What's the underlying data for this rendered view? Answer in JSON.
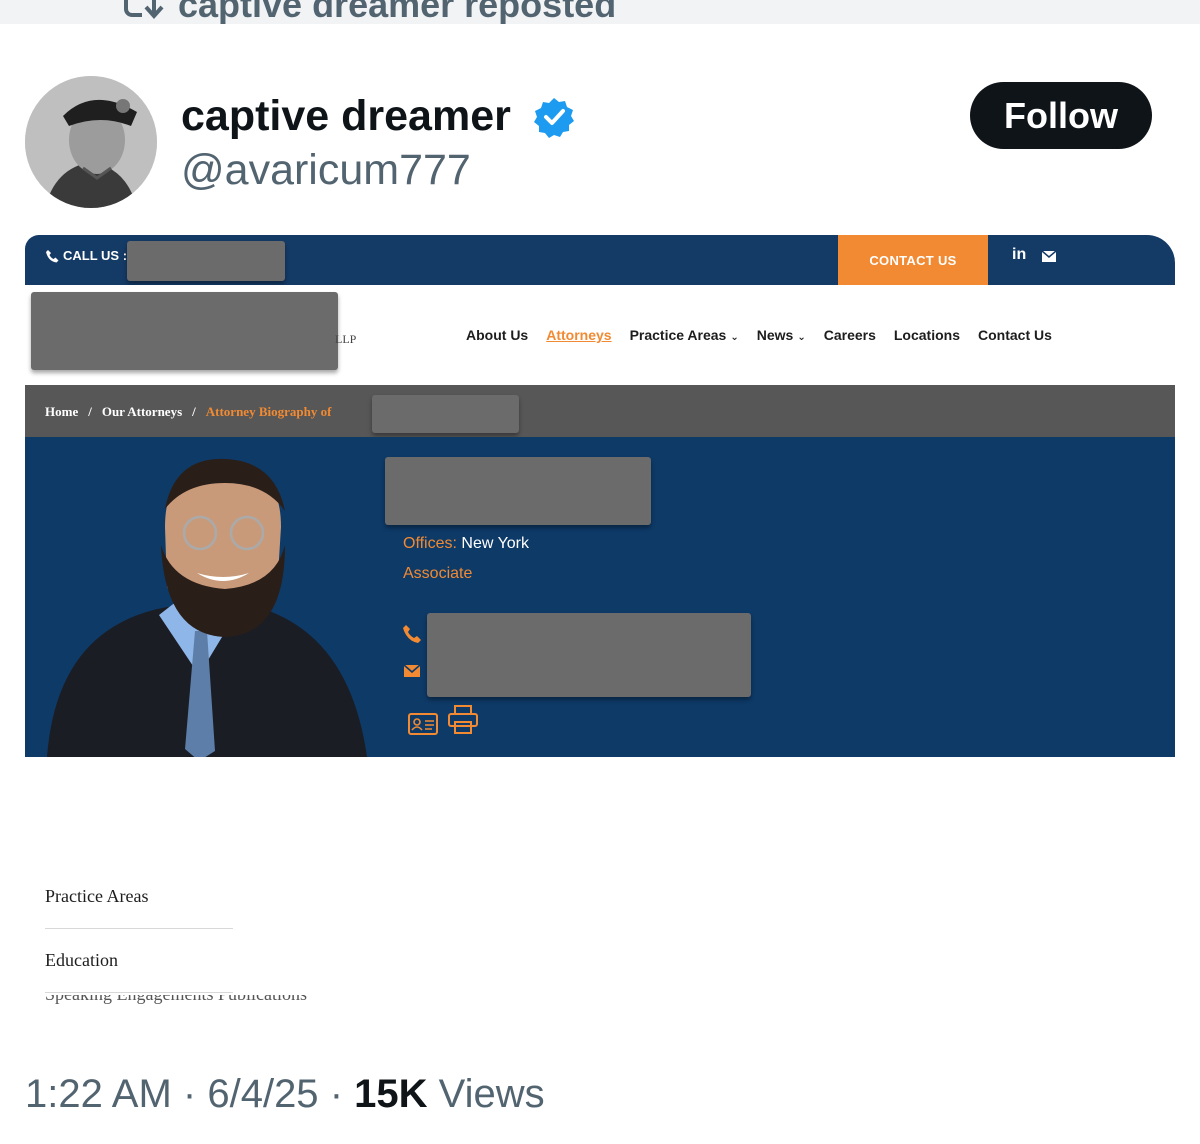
{
  "repost": {
    "text": "captive dreamer reposted",
    "icon": "repost-icon"
  },
  "author": {
    "name": "captive dreamer",
    "handle": "@avaricum777",
    "verified_icon": "verified-badge-icon",
    "follow_label": "Follow"
  },
  "site": {
    "topbar": {
      "call_label": "CALL US :",
      "contact_label": "CONTACT US",
      "linkedin_label": "in"
    },
    "logo_suffix": "LLP",
    "nav": [
      "About Us",
      "Attorneys",
      "Practice Areas",
      "News",
      "Careers",
      "Locations",
      "Contact Us"
    ],
    "nav_active": "Attorneys",
    "breadcrumb": {
      "home": "Home",
      "sep": "/",
      "attorneys": "Our Attorneys",
      "current": "Attorney Biography of"
    },
    "profile": {
      "offices_label": "Offices:",
      "offices_value": "New York",
      "role": "Associate"
    },
    "side_menu": [
      "Practice Areas",
      "Education"
    ],
    "side_fade_text": "Speaking Engagements     Publications",
    "colors": {
      "navy": "#0e3a68",
      "orange": "#f18a32",
      "crumb_gray": "#575757"
    }
  },
  "meta": {
    "time": "1:22 AM",
    "date": "6/4/25",
    "views_count": "15K",
    "views_label": "Views",
    "sep": "·"
  }
}
